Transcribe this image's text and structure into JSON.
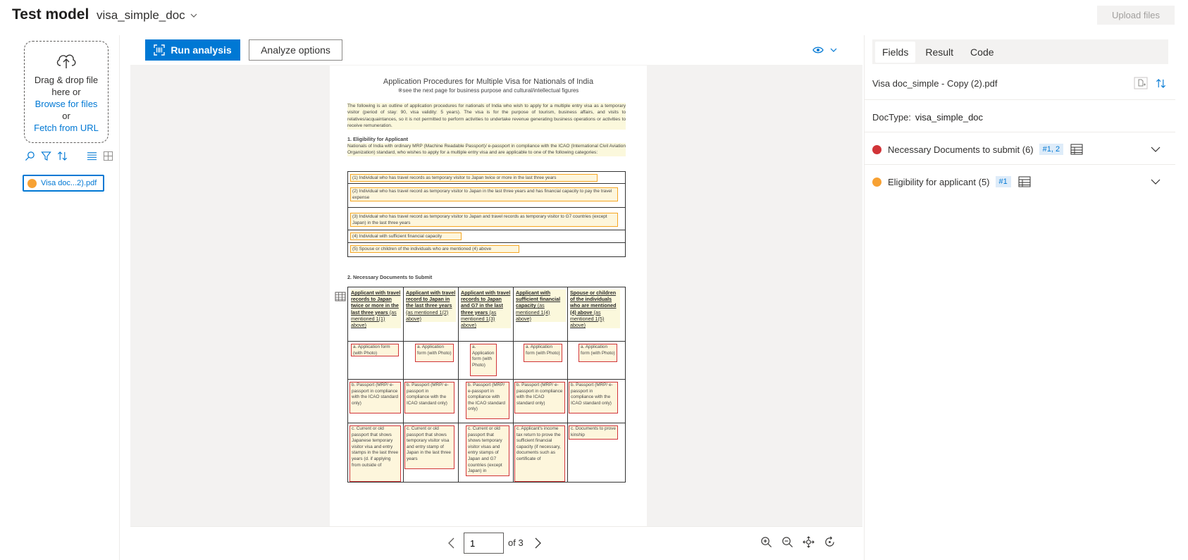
{
  "header": {
    "title": "Test model",
    "model_name": "visa_simple_doc",
    "upload_label": "Upload files"
  },
  "left": {
    "drop_text": "Drag & drop file here or",
    "browse_label": "Browse for files",
    "or_text": "or",
    "fetch_label": "Fetch from URL",
    "file_chip": "Visa doc...2).pdf"
  },
  "toolbar": {
    "run_label": "Run analysis",
    "options_label": "Analyze options"
  },
  "pager": {
    "current_page": "1",
    "of_text": "of 3"
  },
  "document": {
    "title": "Application Procedures for Multiple Visa for Nationals of India",
    "subtitle": "※see the next page for business purpose and cultural/intellectual figures",
    "intro": "The following is an outline of application procedures for nationals of India who wish to apply for a multiple entry visa as a temporary visitor (period of stay: 90, visa validity: 5 years). The visa is for the purpose of tourism, business affairs, and visits to relatives/acquaintances, so it is not permitted to perform activities to undertake revenue generating business operations or activities to receive remuneration.",
    "section1": "1.   Eligibility for Applicant",
    "section1_text": "Nationals of India with ordinary MRP (Machine Readable Passport)/ e-passport in compliance with the ICAO (International Civil Aviation Organization) standard, who wishes to apply for a multiple entry visa and are applicable to one of the following categories:",
    "categories": [
      "(1)  Individual who has travel records as temporary visitor to Japan twice or more in the last three years",
      "(2)  Individual who has travel record as temporary visitor to Japan in the last three years and has financial capacity to pay the travel expense",
      "(3)  Individual who has travel record as temporary visitor to Japan and travel records as temporary visitor to G7 countries (except Japan) in the last three years",
      "(4)  Individual with sufficient financial capacity",
      "(5)  Spouse or children of the individuals who are mentioned (4) above"
    ],
    "section2": "2.   Necessary Documents to Submit",
    "columns": [
      {
        "head": "Applicant with travel records to Japan twice or more in the last three years",
        "sub": "(as mentioned 1(1) above)"
      },
      {
        "head": "Applicant with travel record to Japan in the last three years",
        "sub": "(as mentioned 1(2) above)"
      },
      {
        "head": "Applicant with travel records to Japan and G7 in the last three years",
        "sub": "(as mentioned 1(3) above)"
      },
      {
        "head": "Applicant with sufficient financial capacity",
        "sub": "(as mentioned 1(4) above)"
      },
      {
        "head": "Spouse or children of the individuals who are mentioned (4) above",
        "sub": "(as mentioned 1(5) above)"
      }
    ],
    "row_a": [
      "a. Application form (with Photo)",
      "a. Application form (with Photo)",
      "a. Application form (with Photo)",
      "a. Application form (with Photo)",
      "a. Application form (with Photo)"
    ],
    "row_b": [
      "b. Passport (MRP/ e-passport in compliance with the ICAO standard only)",
      "b. Passport (MRP/ e-passport in compliance with the ICAO standard only)",
      "b. Passport (MRP/ e-passport in compliance with the ICAO standard only)",
      "b. Passport (MRP/ e-passport in compliance with the ICAO standard only)",
      "b. Passport (MRP/ e-passport in compliance with the ICAO standard only)"
    ],
    "row_c": [
      "c. Current or old passport that shows Japanese temporary visitor visa and entry stamps in the last three years (d. if applying from outside of",
      "c. Current or old passport that shows temporary visitor visa and entry stamp of Japan in the last three years",
      "c. Current or old passport that shows temporary visitor visas and entry stamps of Japan and G7 countries (except Japan) in",
      "c. Applicant's income tax return to prove the sufficient financial capacity (if necessary, documents such as certificate of",
      "c. Documents to prove kinship"
    ]
  },
  "right": {
    "tabs": [
      "Fields",
      "Result",
      "Code"
    ],
    "file_name": "Visa doc_simple - Copy (2).pdf",
    "doctype_label": "DocType:",
    "doctype_value": "visa_simple_doc",
    "fields": [
      {
        "label": "Necessary Documents to submit (6)",
        "badge": "#1, 2",
        "color": "#d13438"
      },
      {
        "label": "Eligibility for applicant (5)",
        "badge": "#1",
        "color": "#f7a133"
      }
    ]
  },
  "colors": {
    "accent": "#0078d4",
    "field_red": "#d13438",
    "field_orange": "#f7a133"
  }
}
